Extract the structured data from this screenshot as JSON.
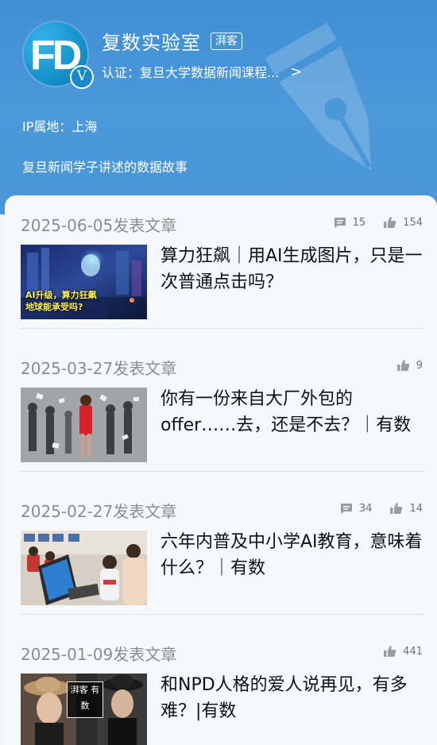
{
  "profile": {
    "avatar_text": "FD",
    "avatar_badge": "V",
    "name": "复数实验室",
    "tag": "湃客",
    "certification": "认证：复旦大学数据新闻课程...",
    "cert_arrow": ">",
    "ip_location": "IP属地：上海",
    "bio": "复旦新闻学子讲述的数据故事"
  },
  "posts": [
    {
      "date": "2025-06-05发表文章",
      "comments": "15",
      "likes": "154",
      "title": "算力狂飙｜用AI生成图片，只是一次普通点击吗？",
      "thumb_caption": "AI升级，算力狂飙\n地球能承受吗?"
    },
    {
      "date": "2025-03-27发表文章",
      "likes": "9",
      "title": "你有一份来自大厂外包的offer……去，还是不去？｜有数"
    },
    {
      "date": "2025-02-27发表文章",
      "comments": "34",
      "likes": "14",
      "title": "六年内普及中小学AI教育，意味着什么？｜有数"
    },
    {
      "date": "2025-01-09发表文章",
      "likes": "441",
      "title": "和NPD人格的爱人说再见，有多难？|有数",
      "thumb_logo": "湃客 有数"
    }
  ],
  "colors": {
    "header_blue": "#4a96d6",
    "text_primary": "#111111",
    "text_secondary": "#8a8d92"
  }
}
